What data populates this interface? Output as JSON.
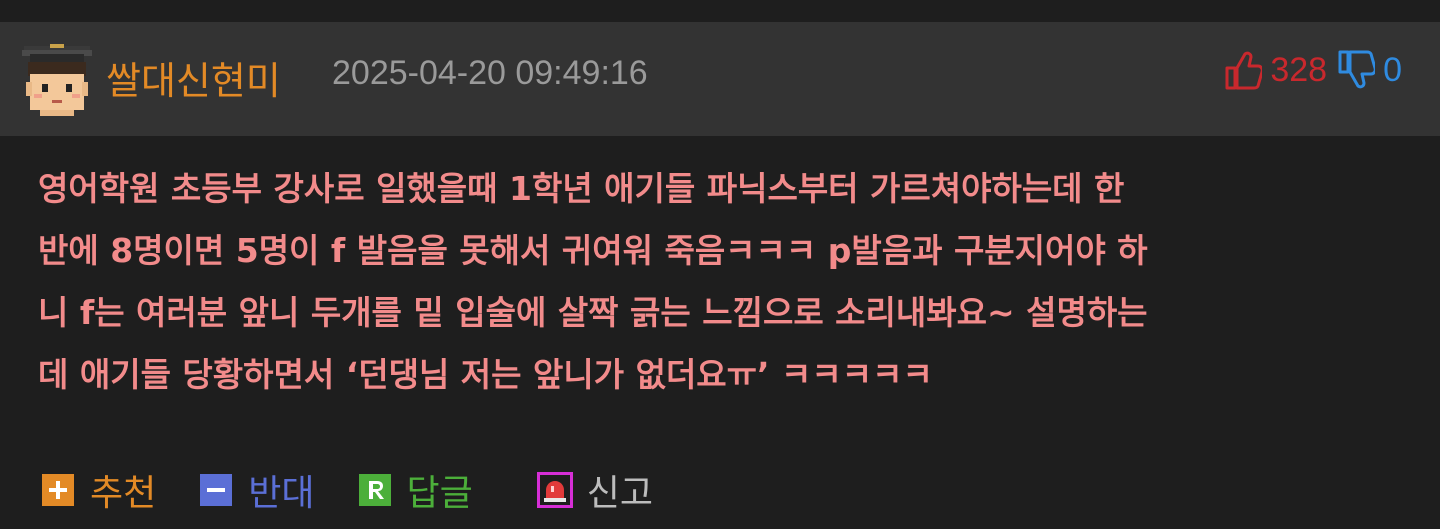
{
  "comment": {
    "author": "쌀대신현미",
    "datetime": "2025-04-20 09:49:16",
    "upvotes": "328",
    "downvotes": "0",
    "body": "영어학원 초등부 강사로 일했을때 1학년 애기들 파닉스부터 가르쳐야하는데 한\n반에 8명이면 5명이 f 발음을 못해서 귀여워 죽음ㅋㅋㅋ p발음과 구분지어야 하\n니 f는 여러분 앞니 두개를 밑 입술에 살짝 긁는 느낌으로 소리내봐요~ 설명하는\n데 애기들 당황하면서 ‘던댕님 저는 앞니가 없더요ㅠ’ ㅋㅋㅋㅋㅋ"
  },
  "actions": {
    "recommend": "추천",
    "oppose": "반대",
    "reply": "답글",
    "report": "신고"
  },
  "icons": {
    "avatar": "pixel-graduate-avatar",
    "upvote": "thumbs-up-icon",
    "downvote": "thumbs-down-icon",
    "recommend": "plus-icon",
    "oppose": "minus-icon",
    "reply": "reply-r-icon",
    "report": "siren-icon"
  },
  "colors": {
    "author": "#e38a26",
    "body": "#f28b8b",
    "upvote": "#c9282d",
    "downvote": "#2f8be0"
  }
}
